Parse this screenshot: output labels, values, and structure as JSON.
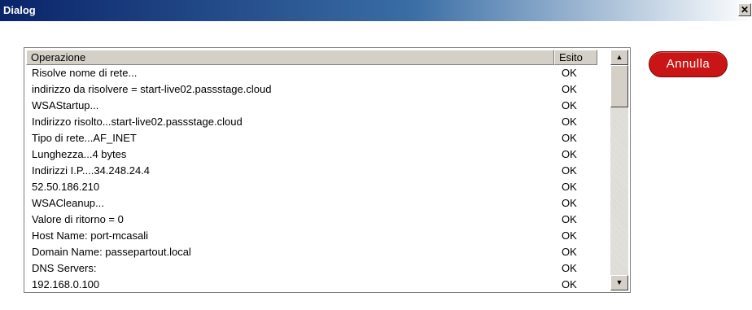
{
  "window": {
    "title": "Dialog",
    "close_glyph": "✕"
  },
  "table": {
    "headers": {
      "operation": "Operazione",
      "result": "Esito"
    },
    "rows": [
      {
        "operation": "Risolve nome di rete...",
        "result": "OK"
      },
      {
        "operation": "indirizzo da risolvere = start-live02.passstage.cloud",
        "result": "OK"
      },
      {
        "operation": "WSAStartup...",
        "result": "OK"
      },
      {
        "operation": "Indirizzo risolto...start-live02.passstage.cloud",
        "result": "OK"
      },
      {
        "operation": "Tipo di rete...AF_INET",
        "result": "OK"
      },
      {
        "operation": "Lunghezza...4 bytes",
        "result": "OK"
      },
      {
        "operation": "Indirizzi I.P....34.248.24.4",
        "result": "OK"
      },
      {
        "operation": "52.50.186.210",
        "result": "OK"
      },
      {
        "operation": "WSACleanup...",
        "result": "OK"
      },
      {
        "operation": "Valore di ritorno = 0",
        "result": "OK"
      },
      {
        "operation": "Host Name: port-mcasali",
        "result": "OK"
      },
      {
        "operation": "Domain Name: passepartout.local",
        "result": "OK"
      },
      {
        "operation": "DNS Servers:",
        "result": "OK"
      },
      {
        "operation": "192.168.0.100",
        "result": "OK"
      }
    ]
  },
  "scrollbar": {
    "up_glyph": "▲",
    "down_glyph": "▼"
  },
  "buttons": {
    "cancel_label": "Annulla"
  },
  "colors": {
    "cancel_bg": "#c91515",
    "titlebar_start": "#0a246a",
    "titlebar_end": "#ffffff"
  }
}
